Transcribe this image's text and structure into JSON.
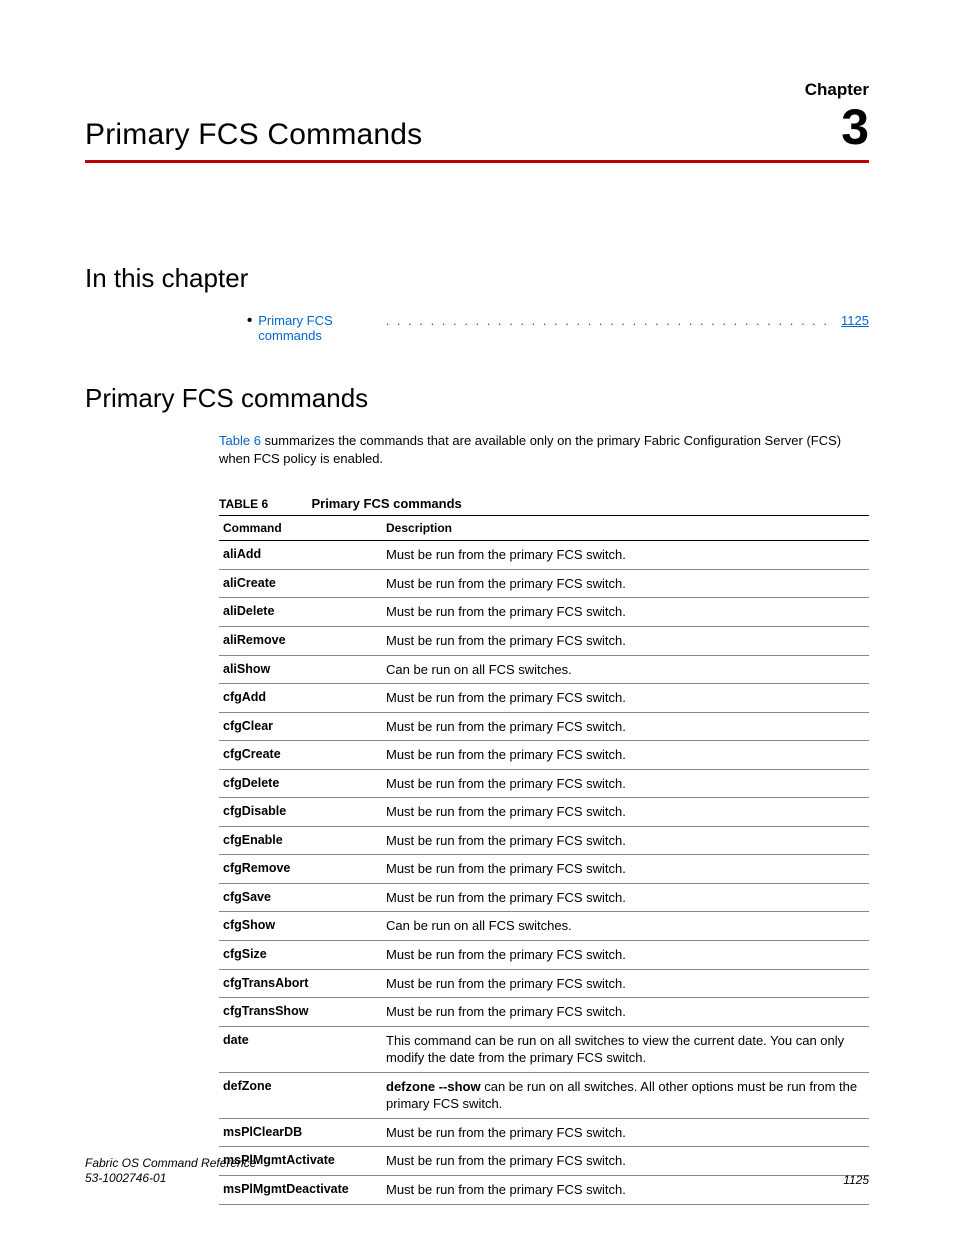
{
  "chapter": {
    "label": "Chapter",
    "number": "3",
    "title": "Primary FCS Commands"
  },
  "sections": {
    "in_this_chapter": "In this chapter",
    "primary_fcs_commands": "Primary FCS commands"
  },
  "toc": {
    "item_label": "Primary FCS commands",
    "dots": ". . . . . . . . . . . . . . . . . . . . . . . . . . . . . . . . . . . . . . . .",
    "page": "1125"
  },
  "intro": {
    "ref": "Table 6",
    "text_after_ref": " summarizes the commands that are available only on the primary Fabric Configuration Server (FCS) when FCS policy is enabled."
  },
  "table": {
    "label": "TABLE 6",
    "caption": "Primary FCS commands",
    "headers": {
      "command": "Command",
      "description": "Description"
    },
    "rows": [
      {
        "cmd": "aliAdd",
        "desc": "Must be run from the primary FCS switch."
      },
      {
        "cmd": "aliCreate",
        "desc": "Must be run from the primary FCS switch."
      },
      {
        "cmd": "aliDelete",
        "desc": "Must be run from the primary FCS switch."
      },
      {
        "cmd": "aliRemove",
        "desc": "Must be run from the primary FCS switch."
      },
      {
        "cmd": "aliShow",
        "desc": "Can be run on all FCS switches."
      },
      {
        "cmd": "cfgAdd",
        "desc": "Must be run from the primary FCS switch."
      },
      {
        "cmd": "cfgClear",
        "desc": "Must be run from the primary FCS switch."
      },
      {
        "cmd": "cfgCreate",
        "desc": "Must be run from the primary FCS switch."
      },
      {
        "cmd": "cfgDelete",
        "desc": "Must be run from the primary FCS switch."
      },
      {
        "cmd": "cfgDisable",
        "desc": "Must be run from the primary FCS switch."
      },
      {
        "cmd": "cfgEnable",
        "desc": "Must be run from the primary FCS switch."
      },
      {
        "cmd": "cfgRemove",
        "desc": "Must be run from the primary FCS switch."
      },
      {
        "cmd": "cfgSave",
        "desc": "Must be run from the primary FCS switch."
      },
      {
        "cmd": "cfgShow",
        "desc": "Can be run on all FCS switches."
      },
      {
        "cmd": "cfgSize",
        "desc": "Must be run from the primary FCS switch."
      },
      {
        "cmd": "cfgTransAbort",
        "desc": "Must be run from the primary FCS switch."
      },
      {
        "cmd": "cfgTransShow",
        "desc": "Must be run from the primary FCS switch."
      },
      {
        "cmd": "date",
        "desc": "This command can be run on all switches to view the current date. You can only modify the date from the primary FCS switch."
      },
      {
        "cmd": "defZone",
        "desc_prefix_bold": "defzone --show",
        "desc_rest": " can be run on all switches. All other options must be run from the primary FCS switch."
      },
      {
        "cmd": "msPlClearDB",
        "desc": "Must be run from the primary FCS switch."
      },
      {
        "cmd": "msPlMgmtActivate",
        "desc": "Must be run from the primary FCS switch."
      },
      {
        "cmd": "msPlMgmtDeactivate",
        "desc": "Must be run from the primary FCS switch."
      }
    ]
  },
  "footer": {
    "doc_title": "Fabric OS Command Reference",
    "doc_number": "53-1002746-01",
    "page_number": "1125"
  }
}
